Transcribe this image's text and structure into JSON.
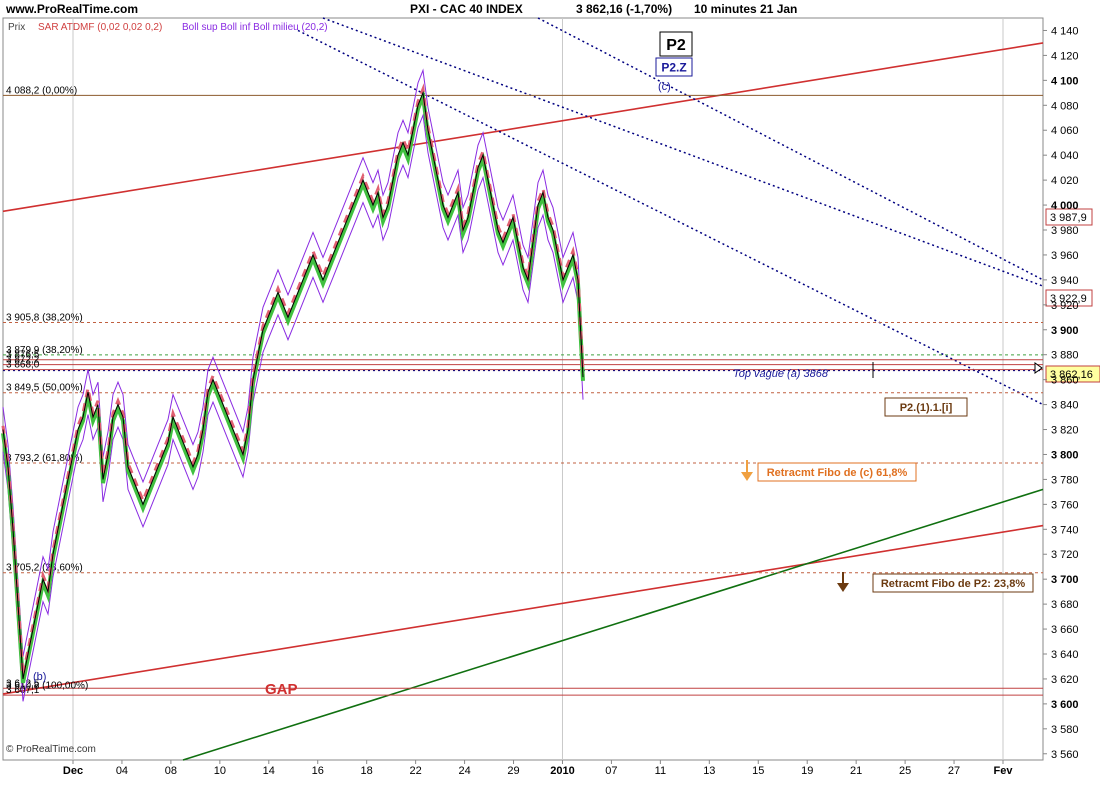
{
  "header": {
    "site": "www.ProRealTime.com",
    "instrument": "PXI - CAC 40 INDEX",
    "quote": "3 862,16 (-1,70%)",
    "period": "10 minutes  21 Jan"
  },
  "indicators": {
    "prix": "Prix",
    "sar": "SAR ATDMF (0,02 0,02 0,2)",
    "boll": "Boll sup Boll inf Boll milieu (20,2)"
  },
  "watermark": "© ProRealTime.com",
  "chart_data": {
    "type": "line",
    "title": "PXI - CAC 40 INDEX",
    "ylim": [
      3555,
      4150
    ],
    "y_ticks": [
      3560,
      3580,
      3600,
      3620,
      3640,
      3660,
      3680,
      3700,
      3720,
      3740,
      3760,
      3780,
      3800,
      3820,
      3840,
      3860,
      3880,
      3900,
      3920,
      3940,
      3960,
      3980,
      4000,
      4020,
      4040,
      4060,
      4080,
      4100,
      4120,
      4140
    ],
    "y_tick_labels": [
      "3 560",
      "3 580",
      "3 600",
      "3 620",
      "3 640",
      "3 660",
      "3 680",
      "3 700",
      "3 720",
      "3 740",
      "3 760",
      "3 780",
      "3 800",
      "3 820",
      "3 840",
      "3 860",
      "3 880",
      "3 900",
      "3 920",
      "3 940",
      "3 960",
      "3 980",
      "4 000",
      "4 020",
      "4 040",
      "4 060",
      "4 080",
      "4 100",
      "4 120",
      "4 140"
    ],
    "x_ticks": [
      {
        "label": "Dec",
        "bold": true
      },
      {
        "label": "04"
      },
      {
        "label": "08"
      },
      {
        "label": "10"
      },
      {
        "label": "14"
      },
      {
        "label": "16"
      },
      {
        "label": "18"
      },
      {
        "label": "22"
      },
      {
        "label": "24"
      },
      {
        "label": "29"
      },
      {
        "label": "2010",
        "bold": true
      },
      {
        "label": "07"
      },
      {
        "label": "11"
      },
      {
        "label": "13"
      },
      {
        "label": "15"
      },
      {
        "label": "19"
      },
      {
        "label": "21"
      },
      {
        "label": "25"
      },
      {
        "label": "27"
      },
      {
        "label": "Fev",
        "bold": true
      }
    ],
    "price_path": [
      [
        0,
        3820
      ],
      [
        5,
        3790
      ],
      [
        10,
        3740
      ],
      [
        15,
        3680
      ],
      [
        20,
        3620
      ],
      [
        25,
        3640
      ],
      [
        30,
        3660
      ],
      [
        35,
        3680
      ],
      [
        40,
        3700
      ],
      [
        45,
        3690
      ],
      [
        50,
        3720
      ],
      [
        55,
        3740
      ],
      [
        60,
        3760
      ],
      [
        65,
        3780
      ],
      [
        70,
        3800
      ],
      [
        75,
        3820
      ],
      [
        80,
        3830
      ],
      [
        85,
        3850
      ],
      [
        90,
        3830
      ],
      [
        95,
        3840
      ],
      [
        100,
        3780
      ],
      [
        105,
        3800
      ],
      [
        110,
        3830
      ],
      [
        115,
        3840
      ],
      [
        120,
        3830
      ],
      [
        125,
        3790
      ],
      [
        130,
        3780
      ],
      [
        135,
        3770
      ],
      [
        140,
        3760
      ],
      [
        145,
        3770
      ],
      [
        150,
        3780
      ],
      [
        155,
        3790
      ],
      [
        160,
        3800
      ],
      [
        165,
        3810
      ],
      [
        170,
        3830
      ],
      [
        175,
        3820
      ],
      [
        180,
        3810
      ],
      [
        185,
        3800
      ],
      [
        190,
        3790
      ],
      [
        195,
        3800
      ],
      [
        200,
        3820
      ],
      [
        205,
        3850
      ],
      [
        210,
        3860
      ],
      [
        215,
        3850
      ],
      [
        220,
        3840
      ],
      [
        225,
        3830
      ],
      [
        230,
        3820
      ],
      [
        235,
        3810
      ],
      [
        240,
        3800
      ],
      [
        245,
        3820
      ],
      [
        250,
        3860
      ],
      [
        255,
        3880
      ],
      [
        260,
        3900
      ],
      [
        265,
        3910
      ],
      [
        270,
        3920
      ],
      [
        275,
        3930
      ],
      [
        280,
        3920
      ],
      [
        285,
        3910
      ],
      [
        290,
        3920
      ],
      [
        295,
        3930
      ],
      [
        300,
        3940
      ],
      [
        305,
        3950
      ],
      [
        310,
        3960
      ],
      [
        315,
        3950
      ],
      [
        320,
        3940
      ],
      [
        325,
        3950
      ],
      [
        330,
        3960
      ],
      [
        335,
        3970
      ],
      [
        340,
        3980
      ],
      [
        345,
        3990
      ],
      [
        350,
        4000
      ],
      [
        355,
        4010
      ],
      [
        360,
        4020
      ],
      [
        365,
        4010
      ],
      [
        370,
        4000
      ],
      [
        375,
        4010
      ],
      [
        380,
        3990
      ],
      [
        385,
        4000
      ],
      [
        390,
        4020
      ],
      [
        395,
        4040
      ],
      [
        400,
        4050
      ],
      [
        405,
        4040
      ],
      [
        410,
        4060
      ],
      [
        415,
        4080
      ],
      [
        420,
        4090
      ],
      [
        425,
        4060
      ],
      [
        430,
        4040
      ],
      [
        435,
        4020
      ],
      [
        440,
        4000
      ],
      [
        445,
        3990
      ],
      [
        450,
        4000
      ],
      [
        455,
        4010
      ],
      [
        460,
        3980
      ],
      [
        465,
        3990
      ],
      [
        470,
        4010
      ],
      [
        475,
        4030
      ],
      [
        480,
        4040
      ],
      [
        485,
        4020
      ],
      [
        490,
        4000
      ],
      [
        495,
        3980
      ],
      [
        500,
        3970
      ],
      [
        505,
        3980
      ],
      [
        510,
        3990
      ],
      [
        515,
        3970
      ],
      [
        520,
        3950
      ],
      [
        525,
        3940
      ],
      [
        530,
        3970
      ],
      [
        535,
        4000
      ],
      [
        540,
        4010
      ],
      [
        545,
        3990
      ],
      [
        550,
        3980
      ],
      [
        555,
        3960
      ],
      [
        560,
        3940
      ],
      [
        565,
        3950
      ],
      [
        570,
        3960
      ],
      [
        575,
        3940
      ],
      [
        580,
        3862
      ]
    ],
    "fibo_levels": [
      {
        "value": 4088,
        "label": "4 088,2 (0,00%)",
        "color": "#8b5a2b",
        "style": "solid"
      },
      {
        "value": 3905.8,
        "label": "3 905,8 (38,20%)",
        "color": "#c06040",
        "style": "dashed"
      },
      {
        "value": 3879.9,
        "label": "3 879,9 (38,20%)",
        "color": "#40a040",
        "style": "dashed"
      },
      {
        "value": 3876,
        "label": "3 876,5",
        "color": "#c04040",
        "style": "solid"
      },
      {
        "value": 3872,
        "label": "3 872,2",
        "color": "#c04040",
        "style": "solid"
      },
      {
        "value": 3868,
        "label": "3 868,0",
        "color": "#c04040",
        "style": "solid"
      },
      {
        "value": 3849.5,
        "label": "3 849,5 (50,00%)",
        "color": "#c06040",
        "style": "dashed"
      },
      {
        "value": 3793.2,
        "label": "3 793,2 (61,80%)",
        "color": "#c06040",
        "style": "dashed"
      },
      {
        "value": 3705.2,
        "label": "3 705,2 (23,60%)",
        "color": "#c06040",
        "style": "dashed"
      },
      {
        "value": 3612.5,
        "label": "3 612,5",
        "color": "#c04040",
        "style": "solid"
      },
      {
        "value": 3607,
        "label": "3 607,1",
        "color": "#c04040",
        "style": "solid"
      },
      {
        "value": 3610.8,
        "label": "3 610,8 (100,00%)",
        "color": "#c04040",
        "style": "none"
      }
    ],
    "horizontal_lines": [
      {
        "value": 3867.5,
        "color": "#000080",
        "style": "dotted"
      }
    ],
    "trend_lines": [
      {
        "points": [
          [
            0,
            3995
          ],
          [
            1040,
            4130
          ]
        ],
        "color": "#d03030",
        "style": "solid"
      },
      {
        "points": [
          [
            0,
            3608
          ],
          [
            1040,
            3743
          ]
        ],
        "color": "#d03030",
        "style": "solid"
      },
      {
        "points": [
          [
            180,
            3555
          ],
          [
            1040,
            3772
          ]
        ],
        "color": "#107010",
        "style": "solid"
      },
      {
        "points": [
          [
            320,
            4150
          ],
          [
            1040,
            3935
          ]
        ],
        "color": "#000080",
        "style": "dotted"
      },
      {
        "points": [
          [
            535,
            4150
          ],
          [
            1040,
            3940
          ]
        ],
        "color": "#000080",
        "style": "dotted"
      },
      {
        "points": [
          [
            295,
            4140
          ],
          [
            1040,
            3840
          ]
        ],
        "color": "#000080",
        "style": "dotted"
      }
    ],
    "price_boxes": [
      {
        "value": 3987.9,
        "label": "3 987,9",
        "bg": "#ffffff",
        "fg": "#000",
        "border": "#c04040"
      },
      {
        "value": 3922.9,
        "label": "3 922,9",
        "bg": "#ffffff",
        "fg": "#000",
        "border": "#c04040"
      },
      {
        "value": 3862.16,
        "label": "3 862,16",
        "bg": "#ffffa0",
        "fg": "#000",
        "border": "#c04040"
      }
    ],
    "annotations": [
      {
        "text": "P2",
        "kind": "box-large",
        "fg": "#000",
        "border": "#000",
        "bg": "#ffffff"
      },
      {
        "text": "P2.Z",
        "kind": "box",
        "fg": "#1a1a9a",
        "border": "#1a1a9a",
        "bg": "#ffffff"
      },
      {
        "text": "(c)",
        "kind": "text",
        "fg": "#1a1a9a"
      },
      {
        "text": "Top vague (a) 3868",
        "kind": "italic",
        "fg": "#1a1a9a"
      },
      {
        "text": "P2.(1).1.[i]",
        "kind": "box",
        "fg": "#6b3a10",
        "border": "#6b3a10",
        "bg": "#ffffff"
      },
      {
        "text": "Retracmt Fibo de (c) 61,8%",
        "kind": "box",
        "fg": "#e07020",
        "border": "#e07020",
        "bg": "#ffffff"
      },
      {
        "text": "Retracmt Fibo de P2: 23,8%",
        "kind": "box",
        "fg": "#6b3a10",
        "border": "#6b3a10",
        "bg": "#ffffff"
      },
      {
        "text": "GAP",
        "kind": "text-big",
        "fg": "#d03030"
      },
      {
        "text": "(b)",
        "kind": "text",
        "fg": "#1a1a9a"
      }
    ]
  }
}
